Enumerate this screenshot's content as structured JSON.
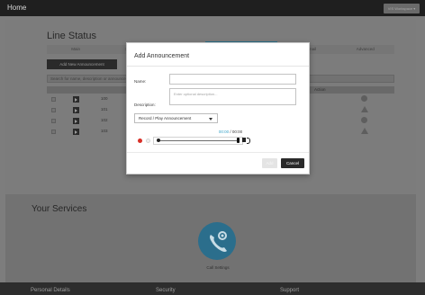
{
  "topbar": {
    "home": "Home",
    "admin_button": "VIS Workspace ▾"
  },
  "line_status": {
    "title": "Line Status",
    "tabs": [
      "Main",
      "Schedule",
      "Call Routing",
      "Announcements",
      "Voicemail",
      "Advanced"
    ],
    "add_new_label": "Add New Announcement",
    "search_placeholder": "Search for name, description or announcement...",
    "status_header": "Action",
    "rows": [
      {
        "number": "100",
        "status": "circle"
      },
      {
        "number": "101",
        "status": "triangle"
      },
      {
        "number": "102",
        "status": "circle"
      },
      {
        "number": "103",
        "status": "triangle"
      }
    ]
  },
  "services": {
    "title": "Your Services",
    "call_settings": "Call Settings"
  },
  "footer": {
    "personal_details": "Personal Details",
    "security": "Security",
    "support": "Support"
  },
  "modal": {
    "title": "Add Announcement",
    "name_label": "Name:",
    "name_value": "",
    "description_label": "Description:",
    "description_placeholder": "Enter optional description...",
    "select_value": "Record / Play Announcement",
    "time_current": "00:00",
    "time_sep": " / ",
    "time_total": "00:00",
    "add_label": "Add",
    "cancel_label": "Cancel"
  },
  "colors": {
    "accent": "#2b6e8c",
    "record": "#d83028",
    "dark_button": "#2a2a2a"
  }
}
